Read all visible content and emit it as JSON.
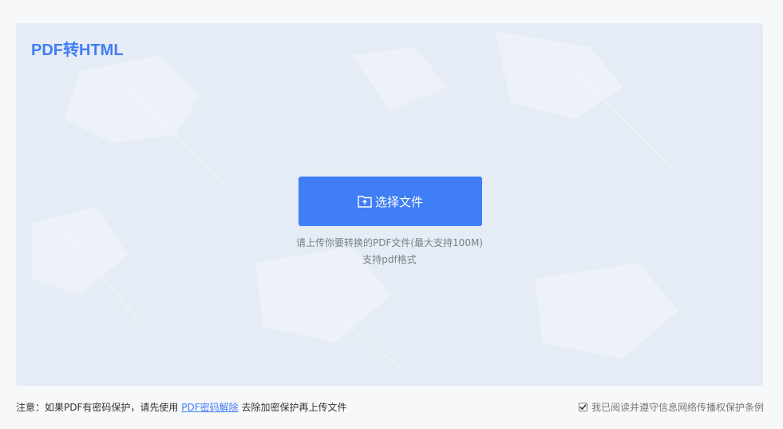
{
  "panel": {
    "title": "PDF转HTML",
    "upload_button_label": "选择文件",
    "upload_icon": "folder-upload-icon",
    "hint_line1": "请上传你要转换的PDF文件(最大支持100M)",
    "hint_line2": "支持pdf格式"
  },
  "footer": {
    "notice_prefix": "注意：如果PDF有密码保护，请先使用",
    "notice_link": "PDF密码解除",
    "notice_suffix": "去除加密保护再上传文件",
    "agreement_checked": true,
    "agreement_label": "我已阅读并遵守信息网络传播权保护条例"
  },
  "colors": {
    "accent": "#3f7ef5",
    "panel_bg": "#e6ecf5",
    "page_bg": "#f7f8fa"
  }
}
